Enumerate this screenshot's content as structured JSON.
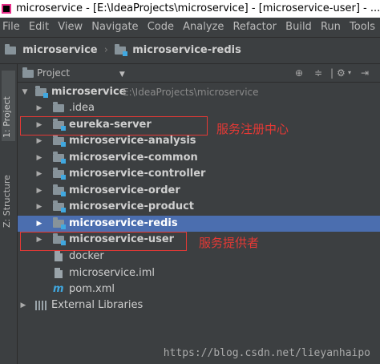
{
  "titlebar": {
    "text": "microservice - [E:\\IdeaProjects\\microservice] - [microservice-user] - ...\\mi"
  },
  "menu": [
    "File",
    "Edit",
    "View",
    "Navigate",
    "Code",
    "Analyze",
    "Refactor",
    "Build",
    "Run",
    "Tools"
  ],
  "breadcrumb": [
    "microservice",
    "microservice-redis"
  ],
  "sidebar": {
    "project_tab": "1: Project",
    "structure_tab": "Z: Structure"
  },
  "panel": {
    "title": "Project"
  },
  "tree": {
    "root": {
      "label": "microservice",
      "path": "E:\\IdeaProjects\\microservice"
    },
    "items": [
      ".idea",
      "eureka-server",
      "microservice-analysis",
      "microservice-common",
      "microservice-controller",
      "microservice-order",
      "microservice-product",
      "microservice-redis",
      "microservice-user",
      "docker",
      "microservice.iml",
      "pom.xml",
      "External Libraries"
    ]
  },
  "annotations": {
    "eureka": "服务注册中心",
    "user": "服务提供者"
  },
  "watermark": "https://blog.csdn.net/lieyanhaipo",
  "colors": {
    "selection": "#4b6eaf",
    "annotation": "#e53935",
    "background": "#3c3f41"
  }
}
